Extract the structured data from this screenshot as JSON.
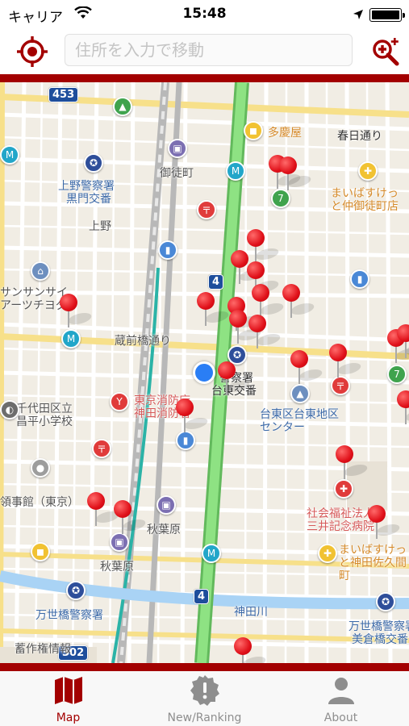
{
  "status_bar": {
    "carrier": "キャリア",
    "time": "15:48"
  },
  "search": {
    "placeholder": "住所を入力で移動"
  },
  "colors": {
    "accent": "#a30000",
    "pin": "#e0111a",
    "main_road": "#7fd37a",
    "user_location": "#2a7ef5"
  },
  "map": {
    "road_badges": [
      "453",
      "4",
      "4",
      "302"
    ],
    "labels": [
      "多慶屋",
      "春日通り",
      "上野警察署",
      "黒門交番",
      "御徒町",
      "上野",
      "まいばすけっと仲御徒町店",
      "サンサンサイ",
      "アーツチヨダ",
      "蔵前橋通り",
      "警察署",
      "台東交番",
      "台東区台東地区センター",
      "千代田区立",
      "昌平小学校",
      "東京消防庁",
      "神田消防署",
      "秋葉原",
      "秋葉原",
      "社会福祉法人",
      "三井記念病院",
      "まいばすけっと神田佐久間町",
      "領事館（東京）",
      "万世橋警察署",
      "神田川",
      "万世橋警察署",
      "美倉橋交番",
      "蓄作権情報"
    ]
  },
  "tabs": [
    {
      "label": "Map",
      "icon": "map-icon",
      "active": true
    },
    {
      "label": "New/Ranking",
      "icon": "badge-exclamation-icon",
      "active": false
    },
    {
      "label": "About",
      "icon": "person-icon",
      "active": false
    }
  ]
}
